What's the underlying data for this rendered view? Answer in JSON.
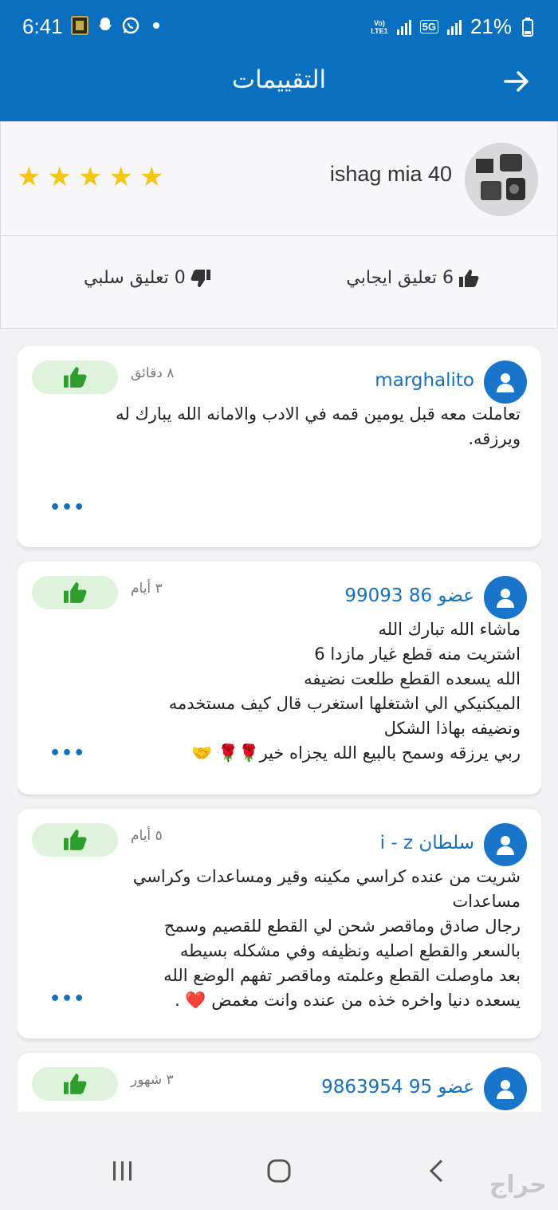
{
  "status_bar": {
    "time": "6:41",
    "battery": "21%",
    "network": "5G",
    "volte": "Vo)\nLTE1"
  },
  "header": {
    "title": "التقييمات"
  },
  "profile": {
    "seller_name": "ishag mia 40",
    "rating_stars": 5,
    "positive_label": "6 تعليق ايجابي",
    "negative_label": "0 تعليق سلبي"
  },
  "reviews": [
    {
      "user": "marghalito",
      "time": "٨ دقائق",
      "text": "تعاملت معه قبل يومين قمه في الادب والامانه الله يبارك له ويرزقه.",
      "more": "•••"
    },
    {
      "user": "عضو 86 99093",
      "time": "٣ أيام",
      "lines": [
        "ماشاء الله تبارك الله",
        "اشتريت منه قطع غيار مازدا 6",
        "الله يسعده القطع طلعت نضيفه",
        "الميكنيكي الي اشتغلها استغرب قال كيف مستخدمه",
        "ونضيفه بهاذا الشكل",
        "ربي يرزقه وسمح بالبيع الله يجزاه خير🌹🌹 🤝"
      ],
      "more": "•••"
    },
    {
      "user": "سلطان i - z",
      "time": "٥ أيام",
      "lines": [
        "شريت من عنده كراسي مكينه وقير ومساعدات وكراسي",
        "مساعدات",
        "رجال صادق وماقصر شحن لي القطع للقصيم وسمح",
        "بالسعر والقطع اصليه ونظيفه وفي مشكله بسيطه",
        "بعد ماوصلت القطع وعلمته وماقصر تفهم الوضع الله",
        "يسعده دنيا واخره خذه من عنده وانت مغمض ❤️ ."
      ],
      "more": "•••"
    },
    {
      "user": "عضو 95 9863954",
      "time": "٣ شهور"
    }
  ],
  "nav": {
    "watermark": "حراج"
  },
  "colors": {
    "primary": "#0b6fc0",
    "star": "#f5c518",
    "like_bg": "#dff3dc",
    "like_icon": "#2e9e2e",
    "link": "#1870b8"
  }
}
